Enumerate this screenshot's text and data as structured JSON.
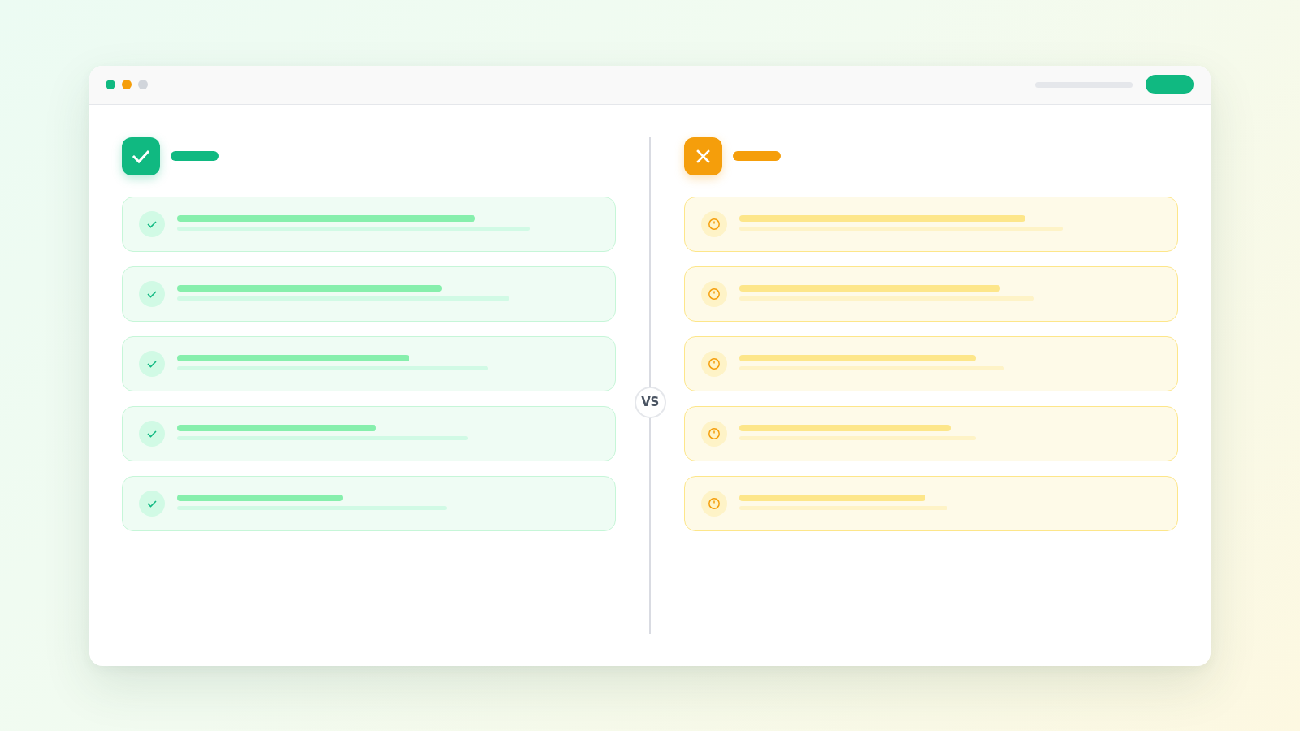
{
  "window": {
    "controls": [
      {
        "color": "#10b981"
      },
      {
        "color": "#f59e0b"
      },
      {
        "color": "#d1d5db"
      }
    ]
  },
  "comparison": {
    "columns": [
      {
        "kind": "positive",
        "items": [
          {
            "kind": "check"
          },
          {
            "kind": "check"
          },
          {
            "kind": "check"
          },
          {
            "kind": "check"
          },
          {
            "kind": "check"
          }
        ]
      },
      {
        "kind": "negative",
        "items": [
          {
            "kind": "alert"
          },
          {
            "kind": "alert"
          },
          {
            "kind": "alert"
          },
          {
            "kind": "alert"
          },
          {
            "kind": "alert"
          }
        ]
      }
    ],
    "divider": {
      "label": "VS"
    }
  }
}
